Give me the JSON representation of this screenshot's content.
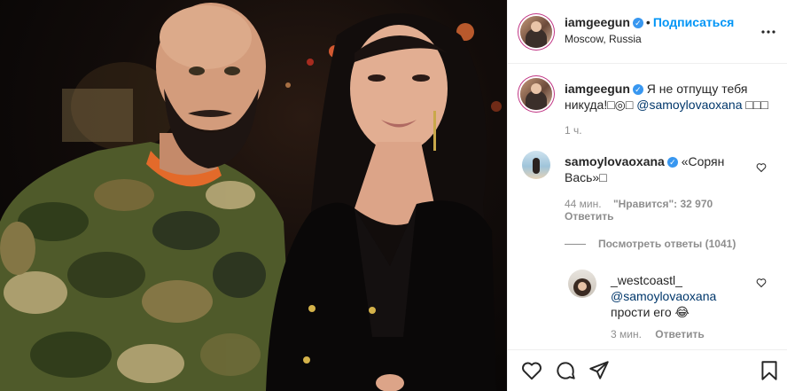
{
  "post": {
    "username": "iamgeegun",
    "follow_label": "Подписаться",
    "separator": "•",
    "location": "Moscow, Russia"
  },
  "caption": {
    "username": "iamgeegun",
    "text": "Я не отпущу тебя никуда!□◎□",
    "mention": "@samoylovaoxana",
    "tail": "□□□",
    "time": "1 ч."
  },
  "comment": {
    "username": "samoylovaoxana",
    "text": "«Сорян Вась»□",
    "time": "44 мин.",
    "likes": "\"Нравится\": 32 970",
    "reply_label": "Ответить",
    "view_replies": "Посмотреть ответы (1041)"
  },
  "reply": {
    "username": "_westcoastl_",
    "mention": "@samoylovaoxana",
    "text": "прости его 😂",
    "time": "3 мин.",
    "reply_label": "Ответить"
  },
  "icons": {
    "like": "heart-icon",
    "comment": "comment-icon",
    "share": "share-icon",
    "save": "bookmark-icon",
    "more": "more-options-icon",
    "verified": "verified-icon"
  },
  "colors": {
    "link": "#0095f6",
    "verified": "#3897f0",
    "mention": "#00376b",
    "muted": "#8e8e8e"
  }
}
